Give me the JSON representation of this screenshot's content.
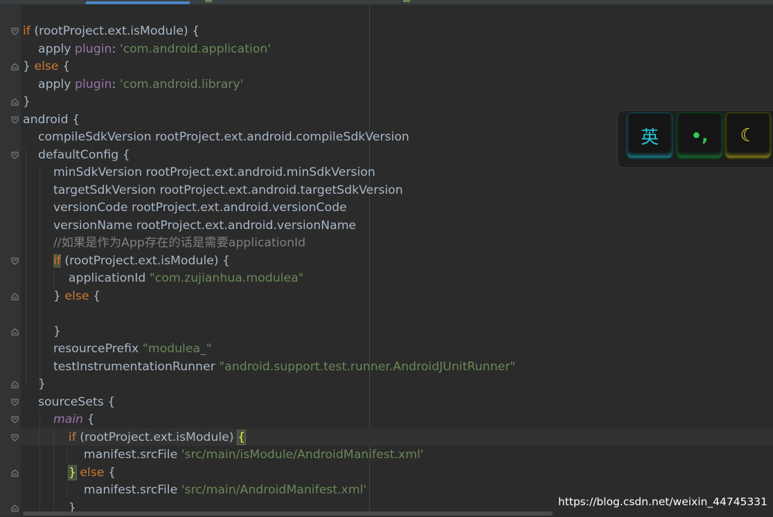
{
  "editor": {
    "lines": [
      {
        "parts": [
          {
            "c": "kw",
            "t": "if"
          },
          {
            "c": "",
            "t": " (rootProject.ext.isModule) {"
          }
        ]
      },
      {
        "parts": [
          {
            "c": "",
            "t": "    apply "
          },
          {
            "c": "ident",
            "t": "plugin"
          },
          {
            "c": "",
            "t": ": "
          },
          {
            "c": "str",
            "t": "'com.android.application'"
          }
        ]
      },
      {
        "parts": [
          {
            "c": "",
            "t": "} "
          },
          {
            "c": "kw",
            "t": "else"
          },
          {
            "c": "",
            "t": " {"
          }
        ]
      },
      {
        "parts": [
          {
            "c": "",
            "t": "    apply "
          },
          {
            "c": "ident",
            "t": "plugin"
          },
          {
            "c": "",
            "t": ": "
          },
          {
            "c": "str",
            "t": "'com.android.library'"
          }
        ]
      },
      {
        "parts": [
          {
            "c": "",
            "t": "}"
          }
        ]
      },
      {
        "parts": [
          {
            "c": "",
            "t": "android {"
          }
        ]
      },
      {
        "parts": [
          {
            "c": "",
            "t": "    compileSdkVersion rootProject.ext.android.compileSdkVersion"
          }
        ]
      },
      {
        "parts": [
          {
            "c": "",
            "t": "    defaultConfig {"
          }
        ]
      },
      {
        "parts": [
          {
            "c": "",
            "t": "        minSdkVersion rootProject.ext.android.minSdkVersion"
          }
        ]
      },
      {
        "parts": [
          {
            "c": "",
            "t": "        targetSdkVersion rootProject.ext.android.targetSdkVersion"
          }
        ]
      },
      {
        "parts": [
          {
            "c": "",
            "t": "        versionCode rootProject.ext.android.versionCode"
          }
        ]
      },
      {
        "parts": [
          {
            "c": "",
            "t": "        versionName rootProject.ext.android.versionName"
          }
        ]
      },
      {
        "parts": [
          {
            "c": "",
            "t": "        "
          },
          {
            "c": "cmt",
            "t": "//如果是作为App存在的话是需要applicationId"
          }
        ]
      },
      {
        "parts": [
          {
            "c": "",
            "t": "        "
          },
          {
            "c": "kw hl-if",
            "t": "if"
          },
          {
            "c": "",
            "t": " (rootProject.ext.isModule) {"
          }
        ]
      },
      {
        "parts": [
          {
            "c": "",
            "t": "            applicationId "
          },
          {
            "c": "str",
            "t": "\"com.zujianhua.modulea\""
          }
        ]
      },
      {
        "parts": [
          {
            "c": "",
            "t": "        } "
          },
          {
            "c": "kw",
            "t": "else"
          },
          {
            "c": "",
            "t": " {"
          }
        ]
      },
      {
        "parts": [
          {
            "c": "",
            "t": ""
          }
        ]
      },
      {
        "parts": [
          {
            "c": "",
            "t": "        }"
          }
        ]
      },
      {
        "parts": [
          {
            "c": "",
            "t": "        resourcePrefix "
          },
          {
            "c": "str",
            "t": "\"modulea_\""
          }
        ]
      },
      {
        "parts": [
          {
            "c": "",
            "t": "        testInstrumentationRunner "
          },
          {
            "c": "str",
            "t": "\"android.support.test.runner.AndroidJUnitRunner\""
          }
        ]
      },
      {
        "parts": [
          {
            "c": "",
            "t": "    }"
          }
        ]
      },
      {
        "parts": [
          {
            "c": "",
            "t": "    sourceSets {"
          }
        ]
      },
      {
        "parts": [
          {
            "c": "",
            "t": "        "
          },
          {
            "c": "it",
            "t": "main"
          },
          {
            "c": "",
            "t": " {"
          }
        ]
      },
      {
        "parts": [
          {
            "c": "",
            "t": "            "
          },
          {
            "c": "kw",
            "t": "if"
          },
          {
            "c": "",
            "t": " (rootProject.ext.isModule) "
          },
          {
            "c": "brace-hl",
            "t": "{"
          }
        ]
      },
      {
        "parts": [
          {
            "c": "",
            "t": "                manifest.srcFile "
          },
          {
            "c": "str",
            "t": "'src/main/isModule/AndroidManifest.xml'"
          }
        ]
      },
      {
        "parts": [
          {
            "c": "",
            "t": "            "
          },
          {
            "c": "brace-hl",
            "t": "}"
          },
          {
            "c": "",
            "t": " "
          },
          {
            "c": "kw",
            "t": "else"
          },
          {
            "c": "",
            "t": " {"
          }
        ]
      },
      {
        "parts": [
          {
            "c": "",
            "t": "                manifest.srcFile "
          },
          {
            "c": "str",
            "t": "'src/main/AndroidManifest.xml'"
          }
        ]
      },
      {
        "parts": [
          {
            "c": "",
            "t": "            }"
          }
        ]
      }
    ],
    "fold_markers": [
      {
        "line": 0,
        "kind": "open"
      },
      {
        "line": 2,
        "kind": "close"
      },
      {
        "line": 4,
        "kind": "close"
      },
      {
        "line": 5,
        "kind": "open"
      },
      {
        "line": 7,
        "kind": "open"
      },
      {
        "line": 13,
        "kind": "open"
      },
      {
        "line": 15,
        "kind": "close"
      },
      {
        "line": 17,
        "kind": "close"
      },
      {
        "line": 20,
        "kind": "close"
      },
      {
        "line": 21,
        "kind": "open"
      },
      {
        "line": 22,
        "kind": "open"
      },
      {
        "line": 23,
        "kind": "open"
      },
      {
        "line": 25,
        "kind": "close"
      },
      {
        "line": 27,
        "kind": "close"
      }
    ]
  },
  "ime_toolbar": {
    "lang_key": "英",
    "punct_key": "•,",
    "mode_key": "☾"
  },
  "watermark": "https://blog.csdn.net/weixin_44745331",
  "colors": {
    "background": "#2b2b2b",
    "keyword": "#cc7832",
    "string": "#6a8759",
    "identifier": "#9876aa",
    "comment": "#808080",
    "text": "#a9b7c6"
  }
}
